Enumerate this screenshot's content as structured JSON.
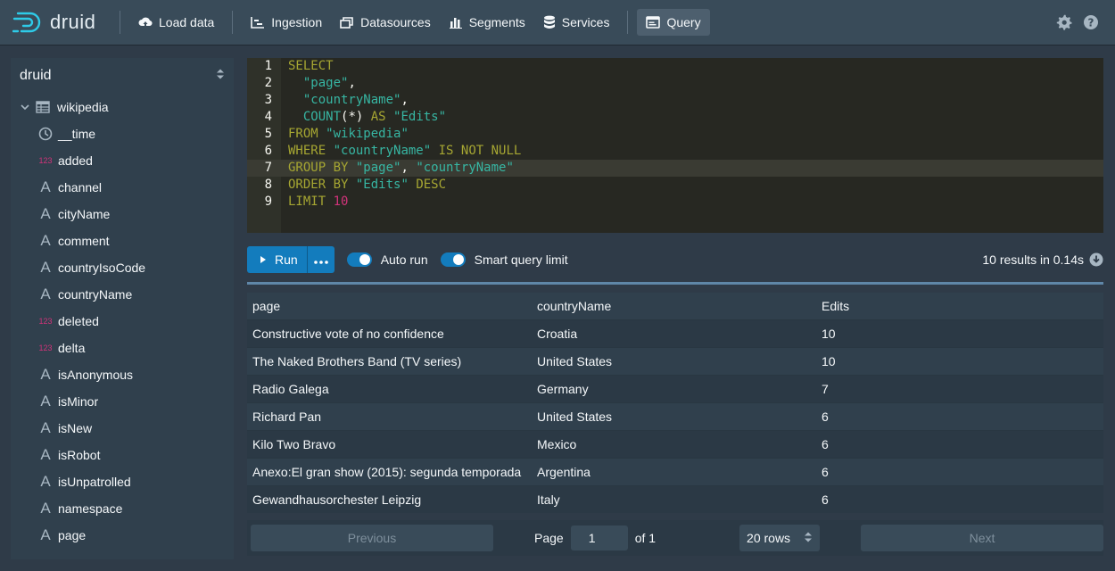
{
  "header": {
    "logo_text": "druid",
    "nav": [
      {
        "label": "Load data",
        "icon": "cloud-upload-icon"
      },
      {
        "label": "Ingestion",
        "icon": "gantt-chart-icon"
      },
      {
        "label": "Datasources",
        "icon": "multi-select-icon"
      },
      {
        "label": "Segments",
        "icon": "stacked-chart-icon"
      },
      {
        "label": "Services",
        "icon": "database-icon"
      },
      {
        "label": "Query",
        "icon": "application-icon"
      }
    ],
    "active": "Query"
  },
  "sidebar": {
    "database": "druid",
    "table": "wikipedia",
    "columns": [
      {
        "name": "__time",
        "type": "time"
      },
      {
        "name": "added",
        "type": "number"
      },
      {
        "name": "channel",
        "type": "string"
      },
      {
        "name": "cityName",
        "type": "string"
      },
      {
        "name": "comment",
        "type": "string"
      },
      {
        "name": "countryIsoCode",
        "type": "string"
      },
      {
        "name": "countryName",
        "type": "string"
      },
      {
        "name": "deleted",
        "type": "number"
      },
      {
        "name": "delta",
        "type": "number"
      },
      {
        "name": "isAnonymous",
        "type": "string"
      },
      {
        "name": "isMinor",
        "type": "string"
      },
      {
        "name": "isNew",
        "type": "string"
      },
      {
        "name": "isRobot",
        "type": "string"
      },
      {
        "name": "isUnpatrolled",
        "type": "string"
      },
      {
        "name": "namespace",
        "type": "string"
      },
      {
        "name": "page",
        "type": "string"
      }
    ],
    "number_icon_text": "123",
    "string_icon_text": "A"
  },
  "editor": {
    "line_numbers": [
      "1",
      "2",
      "3",
      "4",
      "5",
      "6",
      "7",
      "8",
      "9"
    ],
    "highlighted_line": 7,
    "lines": [
      [
        [
          "kw",
          "SELECT"
        ]
      ],
      [
        [
          "plain",
          "  "
        ],
        [
          "str",
          "\"page\""
        ],
        [
          "plain",
          ","
        ]
      ],
      [
        [
          "plain",
          "  "
        ],
        [
          "str",
          "\"countryName\""
        ],
        [
          "plain",
          ","
        ]
      ],
      [
        [
          "plain",
          "  "
        ],
        [
          "fn",
          "COUNT"
        ],
        [
          "plain",
          "(*) "
        ],
        [
          "kw",
          "AS"
        ],
        [
          "plain",
          " "
        ],
        [
          "str",
          "\"Edits\""
        ]
      ],
      [
        [
          "kw",
          "FROM"
        ],
        [
          "plain",
          " "
        ],
        [
          "str",
          "\"wikipedia\""
        ]
      ],
      [
        [
          "kw",
          "WHERE"
        ],
        [
          "plain",
          " "
        ],
        [
          "str",
          "\"countryName\""
        ],
        [
          "plain",
          " "
        ],
        [
          "kw",
          "IS NOT NULL"
        ]
      ],
      [
        [
          "kw",
          "GROUP BY"
        ],
        [
          "plain",
          " "
        ],
        [
          "str",
          "\"page\""
        ],
        [
          "plain",
          ", "
        ],
        [
          "str",
          "\"countryName\""
        ]
      ],
      [
        [
          "kw",
          "ORDER BY"
        ],
        [
          "plain",
          " "
        ],
        [
          "str",
          "\"Edits\""
        ],
        [
          "plain",
          " "
        ],
        [
          "kw",
          "DESC"
        ]
      ],
      [
        [
          "kw",
          "LIMIT"
        ],
        [
          "plain",
          " "
        ],
        [
          "num",
          "10"
        ]
      ]
    ]
  },
  "controls": {
    "run_label": "Run",
    "auto_run_label": "Auto run",
    "smart_limit_label": "Smart query limit",
    "result_info": "10 results in 0.14s"
  },
  "results": {
    "columns": [
      "page",
      "countryName",
      "Edits"
    ],
    "rows": [
      [
        "Constructive vote of no confidence",
        "Croatia",
        "10"
      ],
      [
        "The Naked Brothers Band (TV series)",
        "United States",
        "10"
      ],
      [
        "Radio Galega",
        "Germany",
        "7"
      ],
      [
        "Richard Pan",
        "United States",
        "6"
      ],
      [
        "Kilo Two Bravo",
        "Mexico",
        "6"
      ],
      [
        "Anexo:El gran show (2015): segunda temporada",
        "Argentina",
        "6"
      ],
      [
        "Gewandhausorchester Leipzig",
        "Italy",
        "6"
      ]
    ]
  },
  "pager": {
    "previous_label": "Previous",
    "page_label": "Page",
    "page_value": "1",
    "of_label": "of 1",
    "rows_label": "20 rows",
    "next_label": "Next"
  },
  "colors": {
    "accent": "#137cbd",
    "header_bg": "#394b59",
    "editor_bg": "#272822"
  }
}
